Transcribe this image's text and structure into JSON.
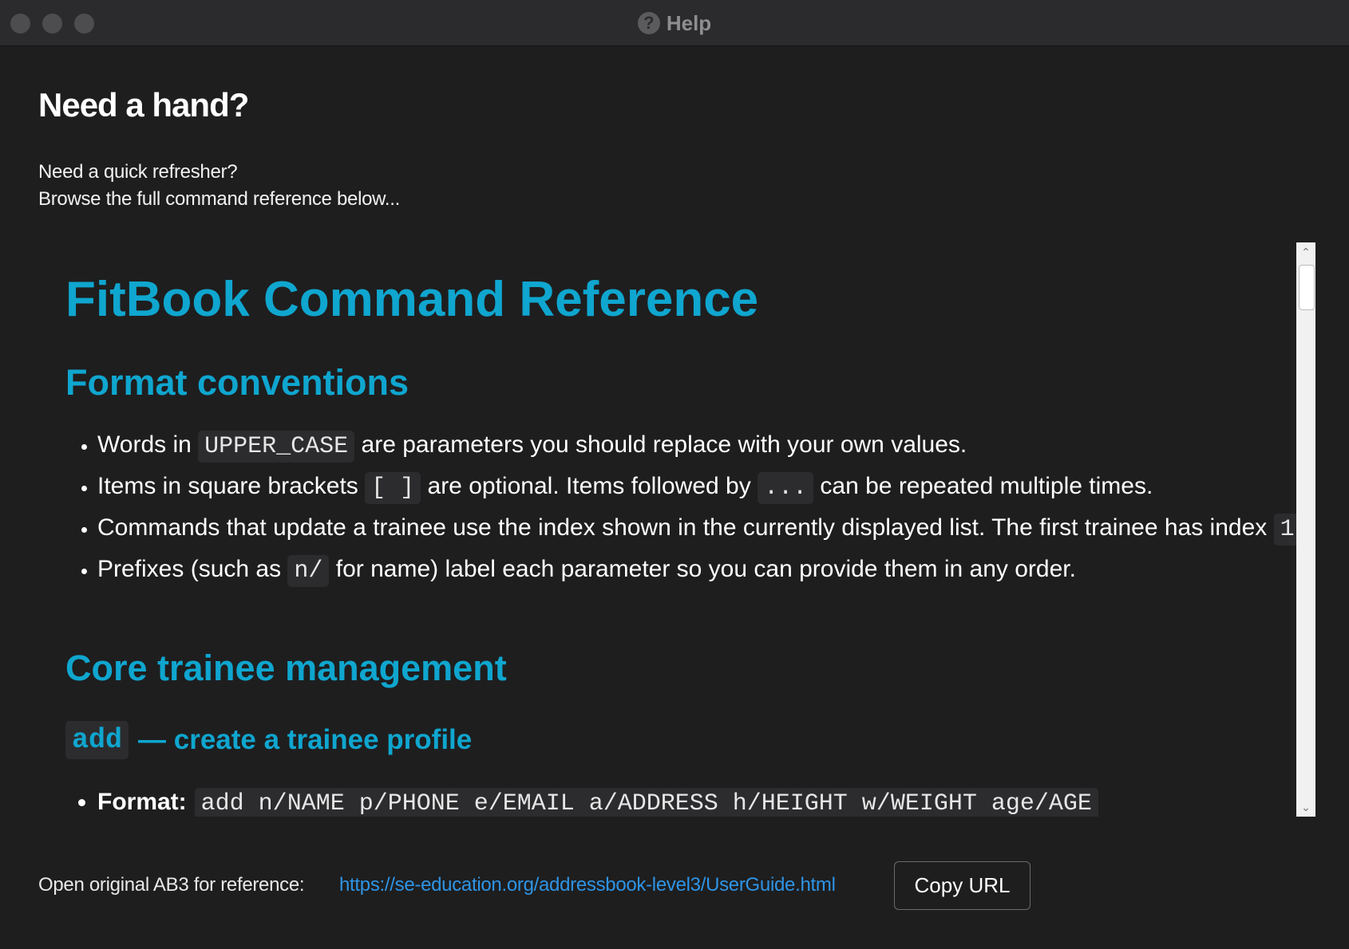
{
  "window": {
    "title": "Help",
    "icon": "help-circle-icon"
  },
  "header": {
    "heading": "Need a hand?",
    "intro_line1": "Need a quick refresher?",
    "intro_line2": "Browse the full command reference below..."
  },
  "doc": {
    "h1": "FitBook Command Reference",
    "section1": "Format conventions",
    "bullets": [
      {
        "pre": "Words in ",
        "code": "UPPER_CASE",
        "post": " are parameters you should replace with your own values."
      },
      {
        "pre": "Items in square brackets ",
        "code": "[ ]",
        "mid": " are optional. Items followed by ",
        "code2": "...",
        "post": " can be repeated multiple times."
      },
      {
        "pre": "Commands that update a trainee use the index shown in the currently displayed list. The first trainee has index ",
        "code": "1",
        "post": "."
      },
      {
        "pre": "Prefixes (such as ",
        "code": "n/",
        "post": " for name) label each parameter so you can provide them in any order."
      }
    ],
    "section2": "Core trainee management",
    "cmd_code": "add",
    "cmd_title": "— create a trainee profile",
    "format_label": "Format:",
    "format_value": "add n/NAME p/PHONE e/EMAIL a/ADDRESS h/HEIGHT w/WEIGHT age/AGE"
  },
  "footer": {
    "label": "Open original AB3 for reference:",
    "url": "https://se-education.org/addressbook-level3/UserGuide.html",
    "copy_button": "Copy URL"
  },
  "colors": {
    "accent": "#0fa6cf",
    "link": "#2e94e5",
    "background": "#1e1e1f"
  }
}
